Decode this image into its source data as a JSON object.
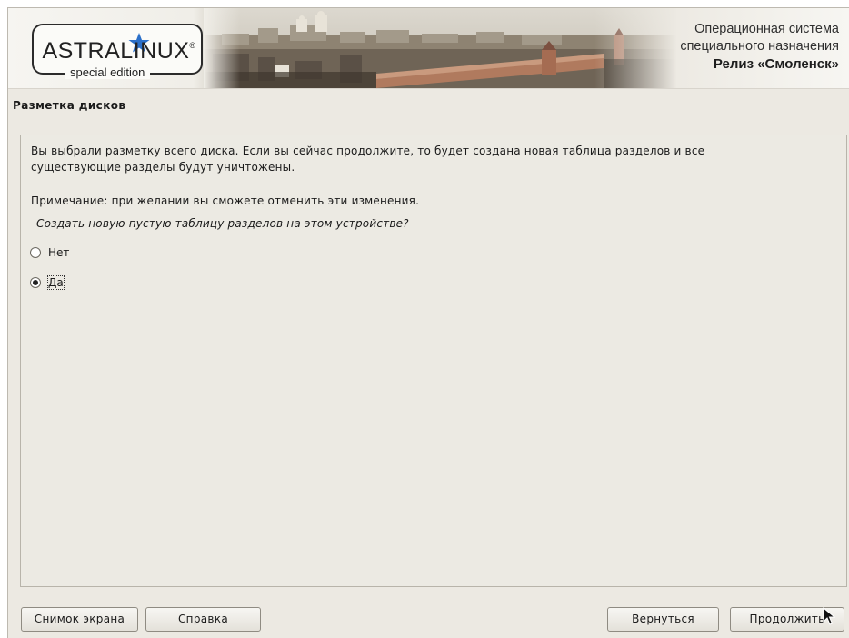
{
  "banner": {
    "logo_main": "ASTRALINUX",
    "logo_registered": "®",
    "logo_sub": "special edition",
    "os_line1": "Операционная система",
    "os_line2": "специального назначения",
    "release": "Релиз «Смоленск»"
  },
  "title": "Разметка дисков",
  "content": {
    "line1": "Вы выбрали разметку всего диска. Если вы сейчас продолжите, то будет создана новая таблица разделов и все",
    "line2": "существующие разделы будут уничтожены.",
    "note": "Примечание: при желании вы сможете отменить эти изменения.",
    "question": "Создать новую пустую таблицу разделов на этом устройстве?",
    "options": [
      {
        "label": "Нет",
        "selected": false
      },
      {
        "label": "Да",
        "selected": true
      }
    ]
  },
  "buttons": {
    "screenshot": "Снимок экрана",
    "help": "Справка",
    "back": "Вернуться",
    "continue": "Продолжить"
  },
  "colors": {
    "background": "#ece9e2",
    "star": "#2a6fc9"
  }
}
